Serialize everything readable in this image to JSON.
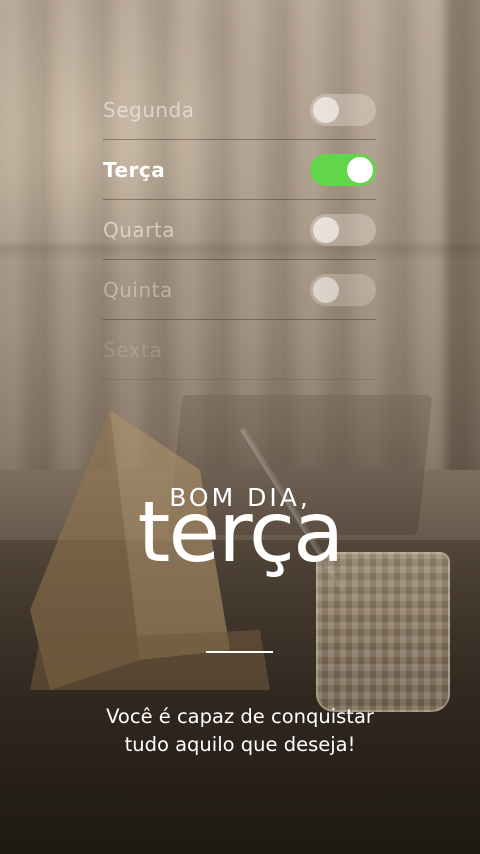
{
  "days": [
    {
      "label": "Segunda",
      "enabled": false
    },
    {
      "label": "Terça",
      "enabled": true
    },
    {
      "label": "Quarta",
      "enabled": false
    },
    {
      "label": "Quinta",
      "enabled": false
    },
    {
      "label": "Sexta",
      "enabled": false
    }
  ],
  "greeting": {
    "intro": "BOM DIA,",
    "day": "terça"
  },
  "message": {
    "line1": "Você é capaz de conquistar",
    "line2": "tudo aquilo que deseja!"
  },
  "colors": {
    "toggle_on": "#62d64b",
    "text": "#ffffff"
  }
}
